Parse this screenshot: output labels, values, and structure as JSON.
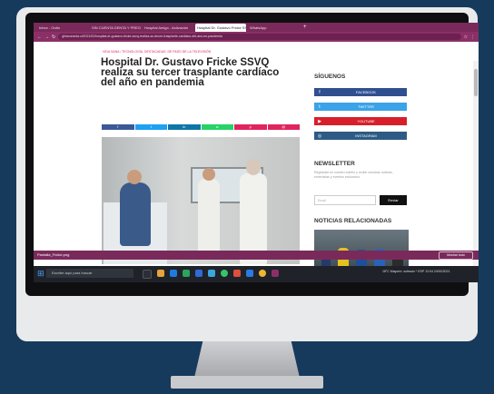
{
  "browser": {
    "tabs": [
      {
        "label": "Inbox - Outlo",
        "active": false
      },
      {
        "label": "SIN CUENTA DENTA Y PREGUN",
        "active": false
      },
      {
        "label": "Hospital Amigo - Activación",
        "active": false
      },
      {
        "label": "Hospital Dr. Gustavo Fricke SSVQ",
        "active": true
      },
      {
        "label": "WhatsApp",
        "active": false
      }
    ],
    "url": "ghiaconecta.cl/2021/02/hospital-dr-gustavo-fricke-ssvq-realiza-su-tercer-trasplante-cardiaco-del-ano-en-pandemia"
  },
  "article": {
    "breadcrumb": "VIDA SANA / TECNOLOGÍA, DESTACADAS, DE PASO DE LA TELEVISIÓN",
    "title": "Hospital Dr. Gustavo Fricke SSVQ realiza su tercer trasplante cardíaco del año en pandemia",
    "share_buttons": [
      {
        "icon": "facebook-icon",
        "glyph": "f",
        "color": "#3b5998"
      },
      {
        "icon": "twitter-icon",
        "glyph": "t",
        "color": "#1da1f2"
      },
      {
        "icon": "linkedin-icon",
        "glyph": "in",
        "color": "#0e76a8"
      },
      {
        "icon": "whatsapp-icon",
        "glyph": "w",
        "color": "#25d366"
      },
      {
        "icon": "pinterest-icon",
        "glyph": "p",
        "color": "#e0245e"
      },
      {
        "icon": "email-icon",
        "glyph": "@",
        "color": "#e0245e"
      }
    ]
  },
  "sidebar": {
    "follow_heading": "SÍGUENOS",
    "social": [
      {
        "label": "FACEBOOK",
        "icon": "facebook-icon",
        "glyph": "f",
        "color": "#2f4f8f"
      },
      {
        "label": "TWITTER",
        "icon": "twitter-icon",
        "glyph": "t",
        "color": "#3ba3e8"
      },
      {
        "label": "YOUTUBE",
        "icon": "youtube-icon",
        "glyph": "▶",
        "color": "#d71f2b"
      },
      {
        "label": "INSTAGRAM",
        "icon": "instagram-icon",
        "glyph": "◎",
        "color": "#2d5b85"
      }
    ],
    "newsletter_heading": "NEWSLETTER",
    "newsletter_text": "Regístrate en nuestro boletín y recibe nuestras noticias, entrevistas y eventos exclusivos.",
    "email_placeholder": "Email",
    "send_label": "Enviar",
    "related_heading": "NOTICIAS RELACIONADAS"
  },
  "downloads": {
    "item": "Pantalla_Fricke.png",
    "show_all": "Mostrar todo"
  },
  "taskbar": {
    "search_placeholder": "Escribe aquí para buscar",
    "tray": "18°C  Mayorm. soleado  ^  ESP  12:04  24/02/2021"
  }
}
